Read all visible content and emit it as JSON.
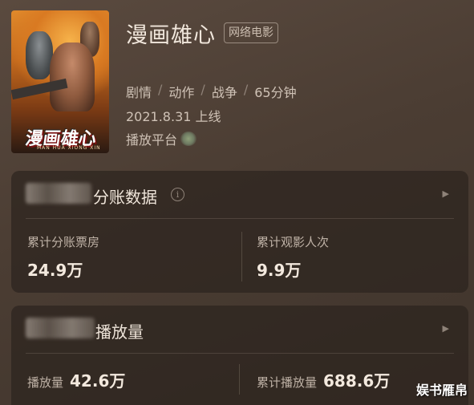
{
  "movie": {
    "title": "漫画雄心",
    "tag": "网络电影",
    "genres": [
      "剧情",
      "动作",
      "战争",
      "65分钟"
    ],
    "release": "2021.8.31 上线",
    "platform_label": "播放平台",
    "poster_title": "漫画雄心",
    "poster_subtitle": "MAN HUA XIONG XIN"
  },
  "box_office_card": {
    "title": "分账数据",
    "left_label": "累计分账票房",
    "left_value": "24.9万",
    "right_label": "累计观影人次",
    "right_value": "9.9万"
  },
  "play_card": {
    "title": "播放量",
    "left_label": "播放量",
    "left_value": "42.6万",
    "right_label": "累计播放量",
    "right_value": "688.6万"
  },
  "icons": {
    "info": "info-icon",
    "arrow": "play-arrow-icon"
  },
  "watermark": "娱书雁帛"
}
